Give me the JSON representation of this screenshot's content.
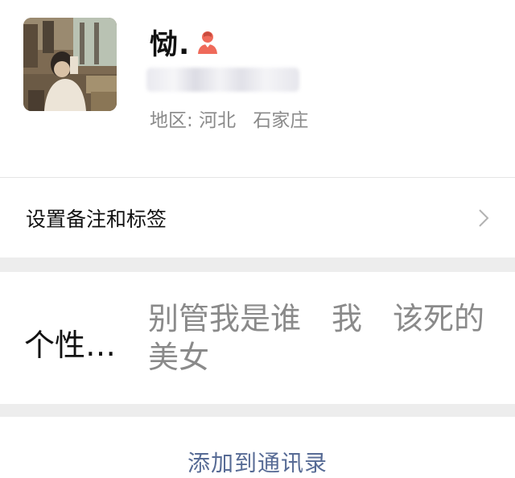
{
  "profile": {
    "display_name": "恸.",
    "gender_icon": "female-person-icon",
    "account_id": "blurred",
    "region_label": "地区:",
    "region_province": "河北",
    "region_city": "石家庄"
  },
  "remark_row": {
    "label": "设置备注和标签",
    "chevron_icon": "chevron-right-icon"
  },
  "signature_row": {
    "label": "个性…",
    "text": "别管我是谁　我　该死的美女"
  },
  "actions": {
    "add_to_contacts": "添加到通讯录"
  },
  "colors": {
    "link_blue": "#576b95",
    "gender_icon": "#ef6a5a",
    "secondary_text": "#8a8a8a",
    "section_gap": "#ededed"
  }
}
